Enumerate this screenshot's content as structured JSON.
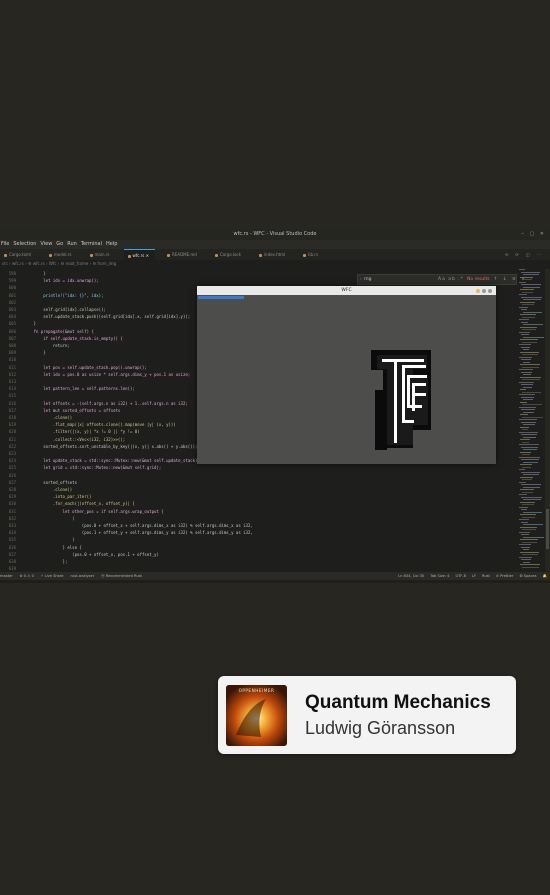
{
  "window": {
    "title": "wfc.rs - WFC - Visual Studio Code",
    "controls": "– ▢ ✕"
  },
  "menu": [
    "File",
    "Selection",
    "View",
    "Go",
    "Run",
    "Terminal",
    "Help"
  ],
  "tabs": [
    {
      "label": "Cargo.toml",
      "active": false
    },
    {
      "label": "model.rs",
      "active": false
    },
    {
      "label": "main.rs",
      "active": false
    },
    {
      "label": "wfc.rs",
      "active": true
    },
    {
      "label": "README.md",
      "active": false
    },
    {
      "label": "Cargo.lock",
      "active": false
    },
    {
      "label": "index.html",
      "active": false
    },
    {
      "label": "lib.rs",
      "active": false
    }
  ],
  "editor_actions": "⟲ ⟳ ◫ ⋯",
  "breadcrumb": "src › wfc.rs › ⚙ wfc.rs › Wfc › ⚙ read_frame › ⚙ from_img",
  "find": {
    "query": "rng",
    "options": "Aa ab .*",
    "result": "No results",
    "tail": "↑ ↓ ≡ ✕"
  },
  "code_lines": [
    {
      "n": "598",
      "t": "        }"
    },
    {
      "n": "599",
      "t": "        let idx = idx.unwrap();"
    },
    {
      "n": "600",
      "t": ""
    },
    {
      "n": "601",
      "t": "        println!(\"idx: {}\", idx);"
    },
    {
      "n": "602",
      "t": ""
    },
    {
      "n": "603",
      "t": "        self.grid[idx].collapse();"
    },
    {
      "n": "604",
      "t": "        self.update_stack.push((self.grid[idx].x, self.grid[idx].y));"
    },
    {
      "n": "605",
      "t": "    }"
    },
    {
      "n": "606",
      "t": "    fn propagate(&mut self) {"
    },
    {
      "n": "607",
      "t": "        if self.update_stack.is_empty() {"
    },
    {
      "n": "608",
      "t": "            return;"
    },
    {
      "n": "609",
      "t": "        }"
    },
    {
      "n": "610",
      "t": ""
    },
    {
      "n": "611",
      "t": "        let pos = self.update_stack.pop().unwrap();"
    },
    {
      "n": "612",
      "t": "        let idx = pos.0 as usize * self.args.dims_y + pos.1 as usize;"
    },
    {
      "n": "613",
      "t": ""
    },
    {
      "n": "614",
      "t": "        let pattern_len = self.patterns.len();"
    },
    {
      "n": "615",
      "t": ""
    },
    {
      "n": "616",
      "t": "        let offsets = -(self.args.n as i32) + 1..self.args.n as i32;"
    },
    {
      "n": "617",
      "t": "        let mut sorted_offsets = offsets"
    },
    {
      "n": "618",
      "t": "            .clone()"
    },
    {
      "n": "619",
      "t": "            .flat_map(|x| offsets.clone().map(move |y| (x, y)))"
    },
    {
      "n": "620",
      "t": "            .filter(|(x, y)| *x != 0 || *y != 0)"
    },
    {
      "n": "621",
      "t": "            .collect::<Vec<(i32, i32)>>();"
    },
    {
      "n": "622",
      "t": "        sorted_offsets.sort_unstable_by_key(|(x, y)| x.abs() + y.abs());"
    },
    {
      "n": "623",
      "t": ""
    },
    {
      "n": "624",
      "t": "        let update_stack = std::sync::Mutex::new(&mut self.update_stack);"
    },
    {
      "n": "625",
      "t": "        let grid = std::sync::Mutex::new(&mut self.grid);"
    },
    {
      "n": "626",
      "t": ""
    },
    {
      "n": "627",
      "t": "        sorted_offsets"
    },
    {
      "n": "628",
      "t": "            .clone()"
    },
    {
      "n": "629",
      "t": "            .into_par_iter()"
    },
    {
      "n": "630",
      "t": "            .for_each(|(offset_x, offset_y)| {"
    },
    {
      "n": "631",
      "t": "                let other_pos = if self.args.wrap_output {"
    },
    {
      "n": "632",
      "t": "                    ("
    },
    {
      "n": "633",
      "t": "                        (pos.0 + offset_x + self.args.dims_x as i32) % self.args.dims_x as i32,"
    },
    {
      "n": "634",
      "t": "                        (pos.1 + offset_y + self.args.dims_y as i32) % self.args.dims_y as i32,"
    },
    {
      "n": "635",
      "t": "                    )"
    },
    {
      "n": "636",
      "t": "                } else {"
    },
    {
      "n": "637",
      "t": "                    (pos.0 + offset_x, pos.1 + offset_y)"
    },
    {
      "n": "638",
      "t": "                };"
    },
    {
      "n": "639",
      "t": ""
    },
    {
      "n": "640",
      "t": "                if other_pos.0 < 0"
    }
  ],
  "status": {
    "left": [
      "master",
      "⊗ 0 ⚠ 0",
      "⚡ Live Share",
      "rust-analyzer",
      "⦿ Recommended Rust"
    ],
    "right": [
      "Ln 634, Col 35",
      "Tab Size: 4",
      "UTF-8",
      "LF",
      "Rust",
      "⊘ Prettier",
      "⚙ Spaces",
      "🔔"
    ]
  },
  "wfc_window": {
    "title": "WFC"
  },
  "now_playing": {
    "track": "Quantum Mechanics",
    "artist": "Ludwig Göransson",
    "album_art_text": "OPPENHEIMER"
  },
  "colors": {
    "background": "#272621",
    "editor_bg": "#1e1f1c",
    "accent_blue": "#4a9eda",
    "card_bg": "#f3f3f3"
  }
}
